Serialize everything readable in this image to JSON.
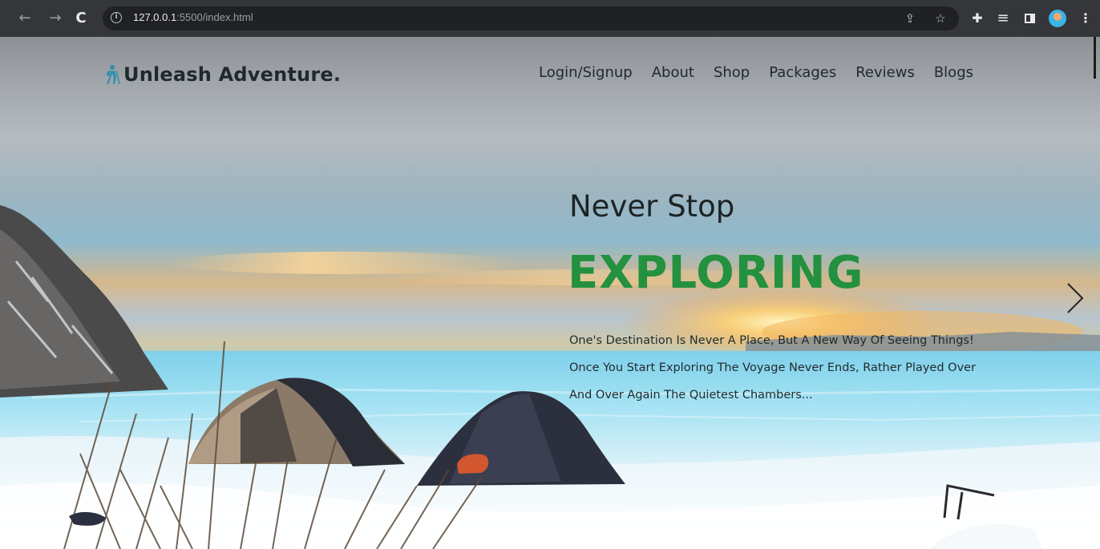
{
  "browser": {
    "url_host": "127.0.0.1",
    "url_rest": ":5500/index.html",
    "icons": [
      "back-icon",
      "forward-icon",
      "reload-icon",
      "site-info-icon",
      "share-icon",
      "bookmark-star-icon",
      "extensions-icon",
      "reading-list-icon",
      "side-panel-icon",
      "profile-avatar",
      "menu-icon"
    ],
    "back_glyph": "←",
    "forward_glyph": "→",
    "reload_glyph": "C",
    "info_glyph": "i",
    "share_glyph": "⇪",
    "star_glyph": "☆",
    "ext_glyph": "✚",
    "list_glyph": "≡",
    "menu_glyph": "⋮"
  },
  "header": {
    "logo_text": "Unleash Adventure.",
    "nav": [
      "Login/Signup",
      "About",
      "Shop",
      "Packages",
      "Reviews",
      "Blogs"
    ]
  },
  "hero": {
    "subtitle": "Never Stop",
    "title": "EXPLORING",
    "description": "One's Destination Is Never A Place, But A New Way Of Seeing Things! Once You Start Exploring The Voyage Never Ends, Rather Played Over And Over Again The Quietest Chambers..."
  },
  "colors": {
    "accent_green": "#23913f",
    "text_dark": "#1f2a2c",
    "logo_icon": "#2b8fb3",
    "chrome_bg": "#35363a",
    "omnibox_bg": "#202124"
  }
}
